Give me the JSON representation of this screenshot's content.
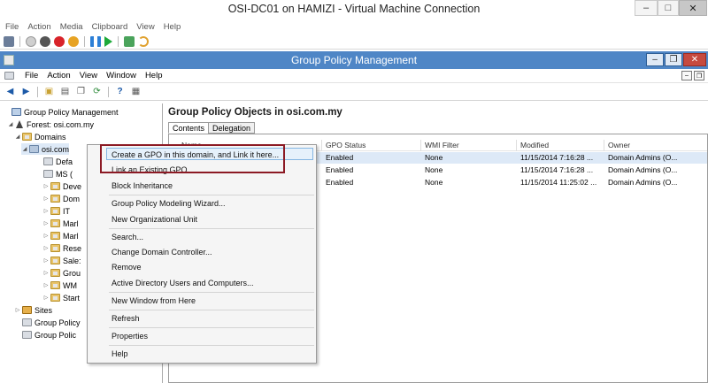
{
  "vm": {
    "title": "OSI-DC01 on HAMIZI - Virtual Machine Connection",
    "menu": [
      "File",
      "Action",
      "Media",
      "Clipboard",
      "View",
      "Help"
    ],
    "toolbar_icons": [
      "ctrl-alt-del-icon",
      "start-icon",
      "turn-off-icon",
      "shutdown-icon",
      "save-icon",
      "pause-icon",
      "resume-icon",
      "checkpoint-icon",
      "revert-icon"
    ],
    "window_controls": {
      "minimize": "–",
      "maximize": "□",
      "close": "✕"
    }
  },
  "gpm": {
    "title": "Group Policy Management",
    "menu": [
      "File",
      "Action",
      "View",
      "Window",
      "Help"
    ],
    "window_controls": {
      "minimize": "–",
      "maximize": "❐",
      "close": "✕"
    },
    "mdi_controls": {
      "minimize": "–",
      "restore": "❐"
    }
  },
  "tree": [
    {
      "label": "Group Policy Management",
      "icon": "root",
      "depth": 0,
      "arrow": ""
    },
    {
      "label": "Forest: osi.com.my",
      "icon": "forest",
      "depth": 1,
      "arrow": "◢"
    },
    {
      "label": "Domains",
      "icon": "ou",
      "depth": 2,
      "arrow": "◢"
    },
    {
      "label": "osi.com",
      "icon": "domain",
      "depth": 3,
      "arrow": "◢"
    },
    {
      "label": "Defa",
      "icon": "gpo",
      "depth": 4,
      "arrow": ""
    },
    {
      "label": "MS (",
      "icon": "gpo",
      "depth": 4,
      "arrow": ""
    },
    {
      "label": "Deve",
      "icon": "ou",
      "depth": 4,
      "arrow": "▷"
    },
    {
      "label": "Dom",
      "icon": "ou",
      "depth": 4,
      "arrow": "▷"
    },
    {
      "label": "IT",
      "icon": "ou",
      "depth": 4,
      "arrow": "▷"
    },
    {
      "label": "Marl",
      "icon": "ou",
      "depth": 4,
      "arrow": "▷"
    },
    {
      "label": "Marl",
      "icon": "ou",
      "depth": 4,
      "arrow": "▷"
    },
    {
      "label": "Rese",
      "icon": "ou",
      "depth": 4,
      "arrow": "▷"
    },
    {
      "label": "Sale:",
      "icon": "ou",
      "depth": 4,
      "arrow": "▷"
    },
    {
      "label": "Grou",
      "icon": "ou",
      "depth": 4,
      "arrow": "▷"
    },
    {
      "label": "WM",
      "icon": "ou",
      "depth": 4,
      "arrow": "▷"
    },
    {
      "label": "Start",
      "icon": "ou",
      "depth": 4,
      "arrow": "▷"
    },
    {
      "label": "Sites",
      "icon": "sites",
      "depth": 1,
      "arrow": "▷"
    },
    {
      "label": "Group Policy",
      "icon": "gpo",
      "depth": 1,
      "arrow": ""
    },
    {
      "label": "Group Polic",
      "icon": "gpo",
      "depth": 1,
      "arrow": ""
    }
  ],
  "right": {
    "title": "Group Policy Objects in osi.com.my",
    "tabs": [
      "Contents",
      "Delegation"
    ],
    "columns": [
      "Name",
      "GPO Status",
      "WMI Filter",
      "Modified",
      "Owner"
    ],
    "rows": [
      {
        "status": "Enabled",
        "wmi": "None",
        "modified": "11/15/2014 7:16:28 ...",
        "owner": "Domain Admins (O..."
      },
      {
        "status": "Enabled",
        "wmi": "None",
        "modified": "11/15/2014 7:16:28 ...",
        "owner": "Domain Admins (O..."
      },
      {
        "status": "Enabled",
        "wmi": "None",
        "modified": "11/15/2014 11:25:02 ...",
        "owner": "Domain Admins (O..."
      }
    ]
  },
  "context_menu": {
    "items": [
      {
        "label": "Create a GPO in this domain, and Link it here...",
        "sep_after": false
      },
      {
        "label": "Link an Existing GPO...",
        "sep_after": false
      },
      {
        "label": "Block Inheritance",
        "sep_after": true
      },
      {
        "label": "Group Policy Modeling Wizard...",
        "sep_after": false
      },
      {
        "label": "New Organizational Unit",
        "sep_after": true
      },
      {
        "label": "Search...",
        "sep_after": false
      },
      {
        "label": "Change Domain Controller...",
        "sep_after": false
      },
      {
        "label": "Remove",
        "sep_after": false
      },
      {
        "label": "Active Directory Users and Computers...",
        "sep_after": true
      },
      {
        "label": "New Window from Here",
        "sep_after": true
      },
      {
        "label": "Refresh",
        "sep_after": true
      },
      {
        "label": "Properties",
        "sep_after": true
      },
      {
        "label": "Help",
        "sep_after": false
      }
    ]
  }
}
